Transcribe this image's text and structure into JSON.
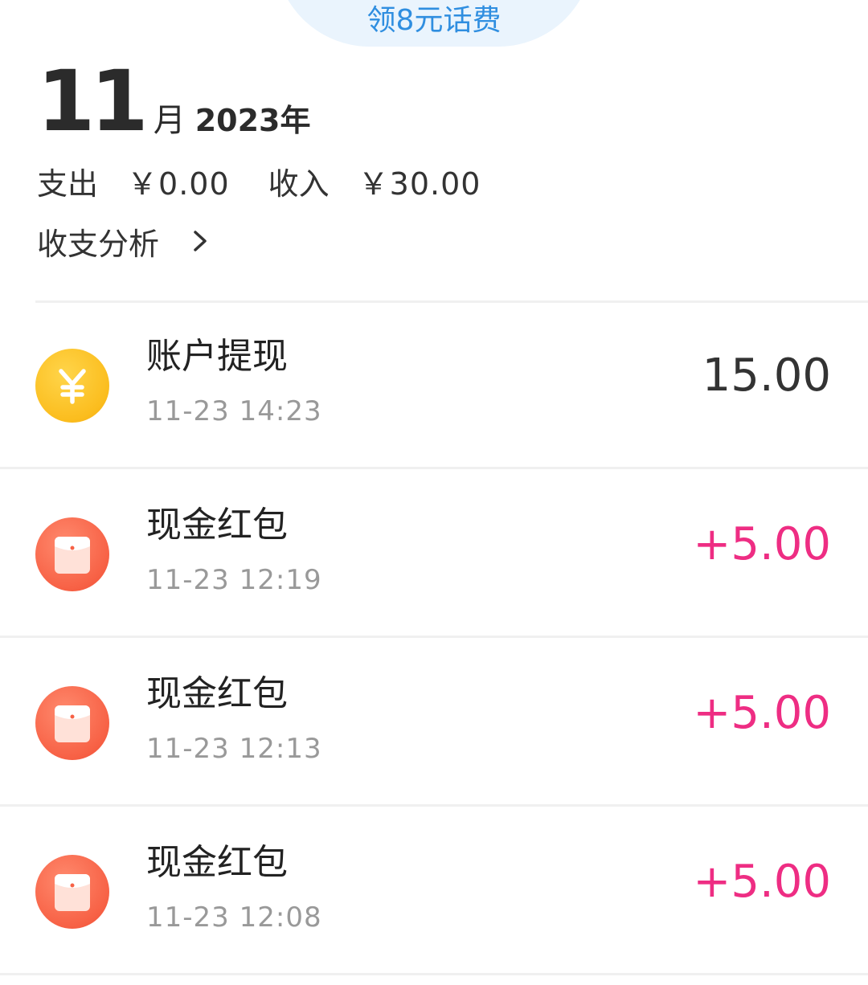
{
  "promo": {
    "label": "领8元话费"
  },
  "period": {
    "month": "11",
    "month_unit": "月",
    "year": "2023年"
  },
  "summary": {
    "expense_label": "支出",
    "expense_value": "￥0.00",
    "income_label": "收入",
    "income_value": "￥30.00"
  },
  "analysis": {
    "label": "收支分析",
    "icon": "chevron-right-icon"
  },
  "colors": {
    "promo_text": "#2f8ee0",
    "promo_bg": "#eaf4fd",
    "positive_amount": "#ee2d83",
    "coin_icon": "#fbbd1e",
    "redpacket_icon": "#f76145"
  },
  "transactions": [
    {
      "icon": "yuan-coin-icon",
      "title": "账户提现",
      "time": "11-23 14:23",
      "amount": "15.00"
    },
    {
      "icon": "red-packet-icon",
      "title": "现金红包",
      "time": "11-23 12:19",
      "amount": "+5.00"
    },
    {
      "icon": "red-packet-icon",
      "title": "现金红包",
      "time": "11-23 12:13",
      "amount": "+5.00"
    },
    {
      "icon": "red-packet-icon",
      "title": "现金红包",
      "time": "11-23 12:08",
      "amount": "+5.00"
    }
  ]
}
